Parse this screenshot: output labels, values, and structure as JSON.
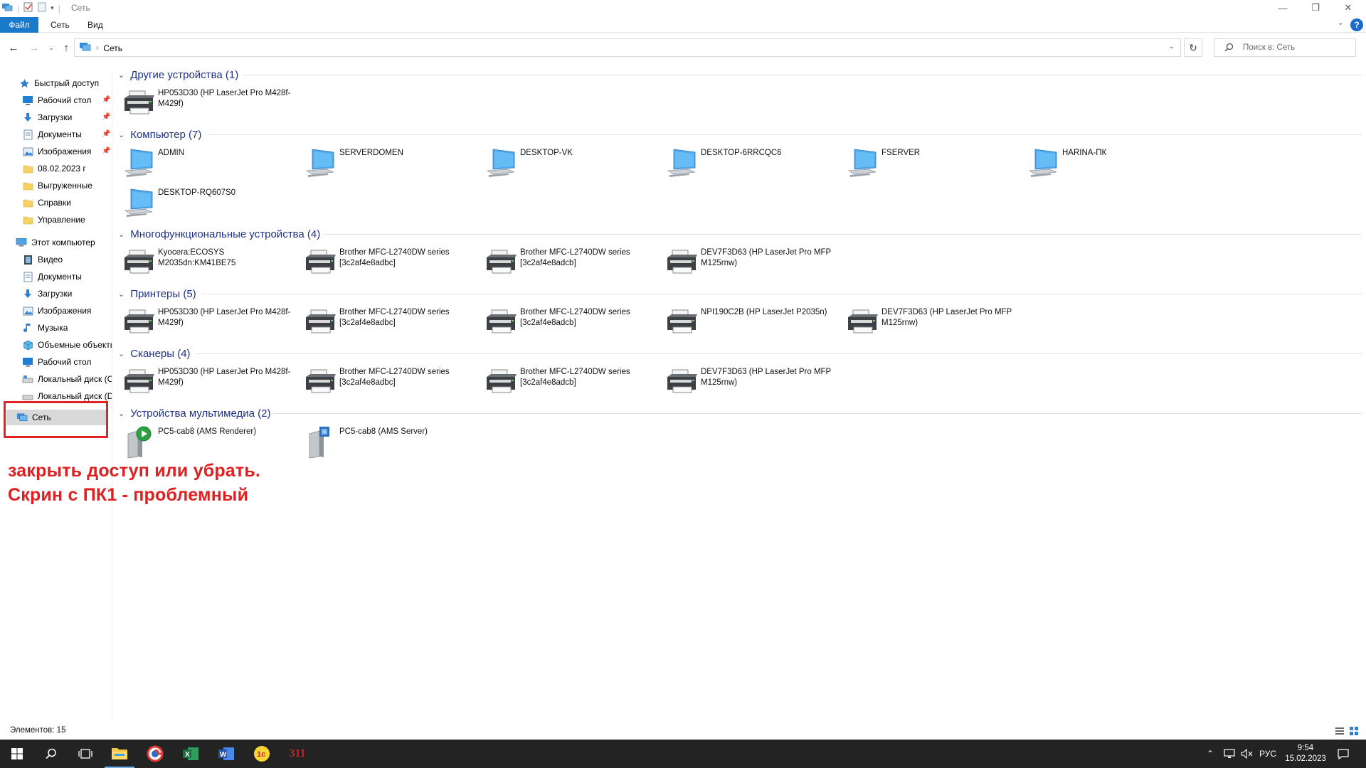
{
  "window": {
    "title": "Сеть",
    "minimize_icon": "minimize-icon",
    "maximize_icon": "restore-icon",
    "close_icon": "close-icon"
  },
  "ribbon": {
    "tabs": [
      "Файл",
      "Сеть",
      "Вид"
    ]
  },
  "address": {
    "crumb": "Сеть",
    "search_placeholder": "Поиск в: Сеть"
  },
  "sidebar": {
    "quick_access": "Быстрый доступ",
    "quick_items": [
      "Рабочий стол",
      "Загрузки",
      "Документы",
      "Изображения",
      "08.02.2023 г",
      "Выгруженные",
      "Справки",
      "Управление"
    ],
    "this_pc": "Этот компьютер",
    "pc_items": [
      "Видео",
      "Документы",
      "Загрузки",
      "Изображения",
      "Музыка",
      "Объемные объекты",
      "Рабочий стол",
      "Локальный диск (C:)",
      "Локальный диск (D:)"
    ],
    "network": "Сеть"
  },
  "annotation": {
    "line1": "закрыть доступ или убрать.",
    "line2": "Скрин с ПК1 - проблемный",
    "color": "#e02020"
  },
  "groups": [
    {
      "title": "Другие устройства (1)",
      "items": [
        {
          "label": "HP053D30 (HP LaserJet Pro M428f-M429f)",
          "icon": "printer-icon"
        }
      ]
    },
    {
      "title": "Компьютер (7)",
      "items": [
        {
          "label": "ADMIN",
          "icon": "computer-icon"
        },
        {
          "label": "SERVERDOMEN",
          "icon": "computer-icon"
        },
        {
          "label": "DESKTOP-VK",
          "icon": "computer-icon"
        },
        {
          "label": "DESKTOP-6RRCQC6",
          "icon": "computer-icon"
        },
        {
          "label": "FSERVER",
          "icon": "computer-icon"
        },
        {
          "label": "HARINA-ПК",
          "icon": "computer-icon"
        },
        {
          "label": "DESKTOP-RQ607S0",
          "icon": "computer-icon"
        }
      ]
    },
    {
      "title": "Многофункциональные устройства (4)",
      "items": [
        {
          "label": "Kyocera:ECOSYS M2035dn:KM41BE75",
          "icon": "printer-icon"
        },
        {
          "label": "Brother MFC-L2740DW series [3c2af4e8adbc]",
          "icon": "printer-icon"
        },
        {
          "label": "Brother MFC-L2740DW series [3c2af4e8adcb]",
          "icon": "printer-icon"
        },
        {
          "label": "DEV7F3D63 (HP LaserJet Pro MFP M125rnw)",
          "icon": "printer-icon"
        }
      ]
    },
    {
      "title": "Принтеры (5)",
      "items": [
        {
          "label": "HP053D30 (HP LaserJet Pro M428f-M429f)",
          "icon": "printer-icon"
        },
        {
          "label": "Brother MFC-L2740DW series [3c2af4e8adbc]",
          "icon": "printer-icon"
        },
        {
          "label": "Brother MFC-L2740DW series [3c2af4e8adcb]",
          "icon": "printer-icon"
        },
        {
          "label": "NPI190C2B (HP LaserJet P2035n)",
          "icon": "printer-icon"
        },
        {
          "label": "DEV7F3D63 (HP LaserJet Pro MFP M125rnw)",
          "icon": "printer-icon"
        }
      ]
    },
    {
      "title": "Сканеры (4)",
      "items": [
        {
          "label": "HP053D30 (HP LaserJet Pro M428f-M429f)",
          "icon": "printer-icon"
        },
        {
          "label": "Brother MFC-L2740DW series [3c2af4e8adbc]",
          "icon": "printer-icon"
        },
        {
          "label": "Brother MFC-L2740DW series [3c2af4e8adcb]",
          "icon": "printer-icon"
        },
        {
          "label": "DEV7F3D63 (HP LaserJet Pro MFP M125rnw)",
          "icon": "printer-icon"
        }
      ]
    },
    {
      "title": "Устройства мультимедиа (2)",
      "items": [
        {
          "label": "PC5-cab8 (AMS Renderer)",
          "icon": "media-renderer-icon"
        },
        {
          "label": "PC5-cab8 (AMS Server)",
          "icon": "media-server-icon"
        }
      ]
    }
  ],
  "status": {
    "items_count": "Элементов: 15"
  },
  "taskbar": {
    "apps": [
      "file-explorer-icon",
      "browser-icon",
      "excel-icon",
      "word-icon",
      "1c-icon",
      "app-311-icon"
    ],
    "app_311_text": "311",
    "lang": "РУС",
    "time": "9:54",
    "date": "15.02.2023"
  }
}
